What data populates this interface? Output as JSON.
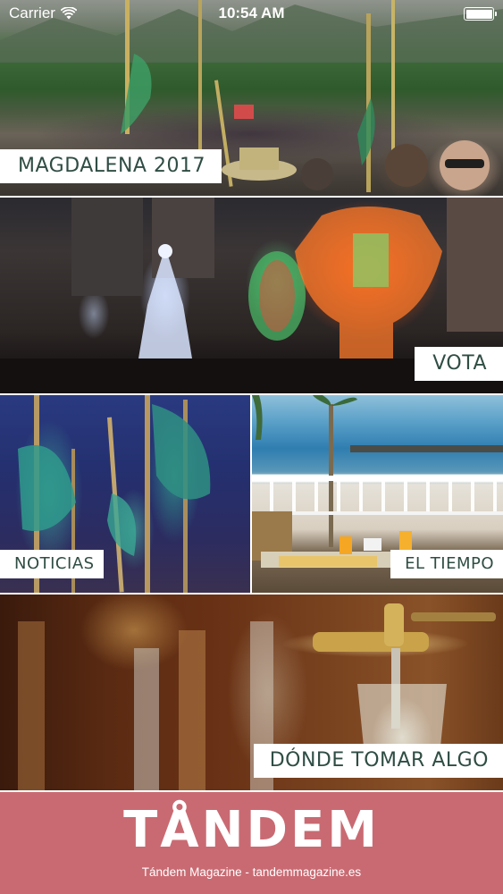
{
  "status_bar": {
    "carrier": "Carrier",
    "time": "10:54 AM",
    "wifi_icon": "wifi-icon",
    "battery_icon": "battery-icon"
  },
  "tiles": [
    {
      "id": "magdalena",
      "label": "MAGDALENA 2017",
      "photo": "festival-crowd-photo"
    },
    {
      "id": "vota",
      "label": "VOTA",
      "photo": "illuminated-floats-photo"
    },
    {
      "id": "noticias",
      "label": "NOTICIAS",
      "photo": "green-ribbon-canes-photo"
    },
    {
      "id": "tiempo",
      "label": "EL TIEMPO",
      "photo": "beach-balcony-photo"
    },
    {
      "id": "tomar",
      "label": "DÓNDE TOMAR ALGO",
      "photo": "beer-tap-photo"
    }
  ],
  "footer": {
    "brand": "TÅNDEM",
    "tagline": "Tándem Magazine - tandemmagazine.es",
    "background_color": "#c96a72"
  },
  "colors": {
    "label_text": "#2f4d44",
    "label_background": "#ffffff"
  }
}
